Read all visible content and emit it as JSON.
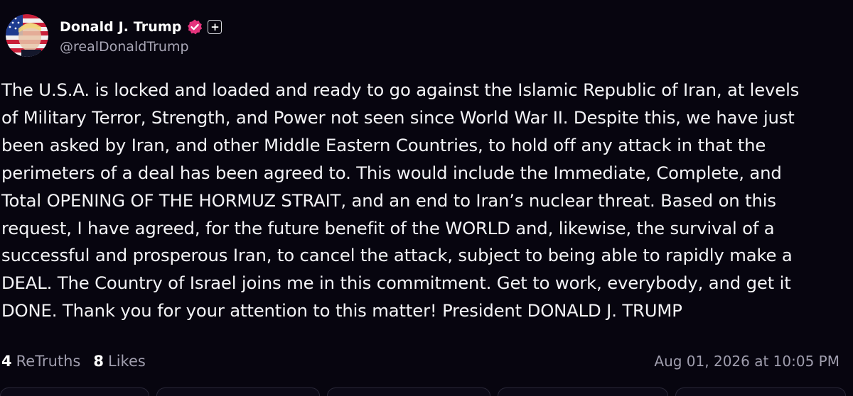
{
  "author": {
    "display_name": "Donald J. Trump",
    "handle": "@realDonaldTrump",
    "verified_icon": "verified-badge-icon",
    "plus_badge": "+"
  },
  "post": {
    "text": "The U.S.A. is locked and loaded and ready to go against the Islamic Republic of Iran, at levels\nof Military Terror, Strength, and Power not seen since World War II. Despite this, we have just\nbeen asked by Iran, and other Middle Eastern Countries, to hold off any attack in that the\nperimeters of a deal has been agreed to. This would include the Immediate, Complete, and\nTotal OPENING OF THE HORMUZ STRAIT, and an end to Iran’s  nuclear threat. Based on this\nrequest, I have agreed, for the future benefit of the WORLD and, likewise, the survival of a\nsuccessful and prosperous Iran, to cancel the attack, subject to being able to rapidly make a\nDEAL. The Country of Israel joins me in this commitment. Get to work, everybody, and get it\nDONE. Thank you for your attention to this matter! President DONALD J. TRUMP"
  },
  "stats": {
    "retruths_count": "4",
    "retruths_label": "ReTruths",
    "likes_count": "8",
    "likes_label": "Likes"
  },
  "timestamp": "Aug 01, 2026 at 10:05 PM",
  "colors": {
    "background": "#07050f",
    "verified": "#e4337c",
    "muted_text": "#a09eae"
  }
}
